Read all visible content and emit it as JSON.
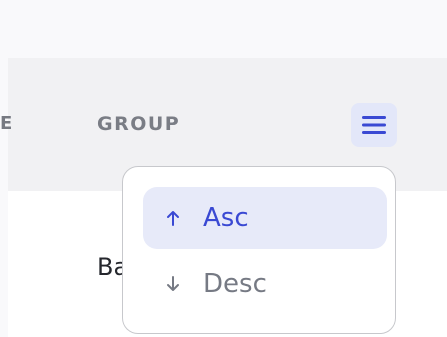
{
  "table": {
    "prev_column_label": "E",
    "group_column_label": "GROUP",
    "cell_text": "Ba"
  },
  "sort_menu": {
    "options": [
      {
        "label": "Asc",
        "icon": "arrow-up-icon",
        "selected": true
      },
      {
        "label": "Desc",
        "icon": "arrow-down-icon",
        "selected": false
      }
    ]
  },
  "colors": {
    "accent": "#3a49d3",
    "accent_bg": "#e7eaf9",
    "header_bg": "#f1f1f3",
    "muted_text": "#7a7d85"
  }
}
